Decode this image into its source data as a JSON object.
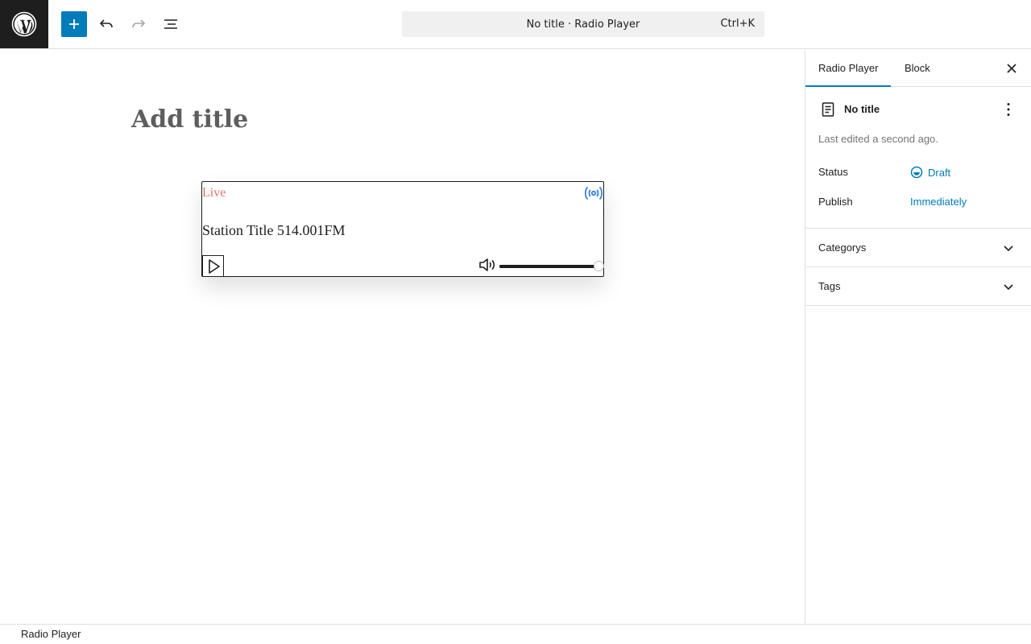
{
  "header": {
    "command_bar_label": "No title · Radio Player",
    "command_shortcut": "Ctrl+K"
  },
  "editor": {
    "title_placeholder": "Add title",
    "radio_player": {
      "live_label": "Live",
      "station_title": "Station Title 514.001FM",
      "volume_level": 1.0
    }
  },
  "sidebar": {
    "tabs": [
      {
        "label": "Radio Player",
        "active": true
      },
      {
        "label": "Block",
        "active": false
      }
    ],
    "doc_title": "No title",
    "last_edited": "Last edited a second ago.",
    "status_label": "Status",
    "status_value": "Draft",
    "publish_label": "Publish",
    "publish_value": "Immediately",
    "panels": [
      {
        "title": "Categorys"
      },
      {
        "title": "Tags"
      }
    ]
  },
  "footer": {
    "breadcrumb": "Radio Player"
  },
  "colors": {
    "accent": "#007cba",
    "live": "#e8736a",
    "broadcast_icon": "#3582e0"
  },
  "icons": [
    "wordpress-logo",
    "plus-icon",
    "undo-icon",
    "redo-icon",
    "list-view-icon",
    "broadcast-icon",
    "play-icon",
    "volume-icon",
    "close-icon",
    "document-icon",
    "more-vertical-icon",
    "draft-status-icon",
    "chevron-down-icon"
  ]
}
